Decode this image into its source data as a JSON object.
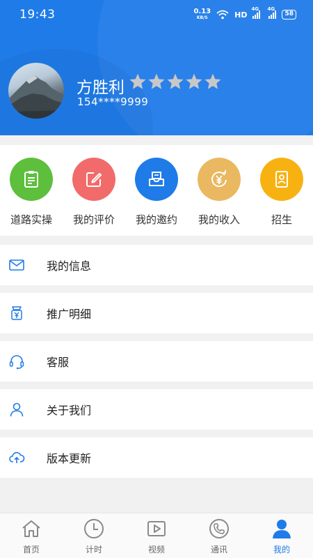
{
  "status_bar": {
    "time": "19:43",
    "net_speed_value": "0.13",
    "net_speed_unit": "KB/S",
    "hd_label": "HD",
    "signal1_label": "4G",
    "signal2_label": "4G",
    "battery": "58"
  },
  "profile": {
    "name": "方胜利",
    "phone": "154****9999",
    "rating_stars": 5,
    "rating_filled": 0,
    "star_color": "#c8c8c8"
  },
  "quick_actions": [
    {
      "label": "道路实操",
      "icon": "clipboard-icon",
      "color": "#5dbf3c"
    },
    {
      "label": "我的评价",
      "icon": "edit-icon",
      "color": "#f26b6b"
    },
    {
      "label": "我的邀约",
      "icon": "invite-inbox-icon",
      "color": "#1f7be8"
    },
    {
      "label": "我的收入",
      "icon": "yen-income-icon",
      "color": "#e9b861"
    },
    {
      "label": "招生",
      "icon": "enroll-contact-icon",
      "color": "#f7b212"
    }
  ],
  "menu": [
    {
      "label": "我的信息",
      "icon": "mail-icon"
    },
    {
      "label": "推广明细",
      "icon": "promotion-icon"
    },
    {
      "label": "客服",
      "icon": "headset-icon"
    },
    {
      "label": "关于我们",
      "icon": "person-icon"
    },
    {
      "label": "版本更新",
      "icon": "cloud-upload-icon"
    }
  ],
  "tabbar": {
    "items": [
      {
        "label": "首页",
        "icon": "home-icon",
        "active": false
      },
      {
        "label": "计时",
        "icon": "clock-icon",
        "active": false
      },
      {
        "label": "视频",
        "icon": "video-play-icon",
        "active": false
      },
      {
        "label": "通讯",
        "icon": "phone-call-icon",
        "active": false
      },
      {
        "label": "我的",
        "icon": "profile-icon",
        "active": true
      }
    ],
    "active_color": "#1f7be8",
    "inactive_color": "#8a8a8a"
  },
  "colors": {
    "header_bg": "#1f7be8",
    "page_bg": "#f1f1f1",
    "menu_icon": "#1f7be8"
  }
}
